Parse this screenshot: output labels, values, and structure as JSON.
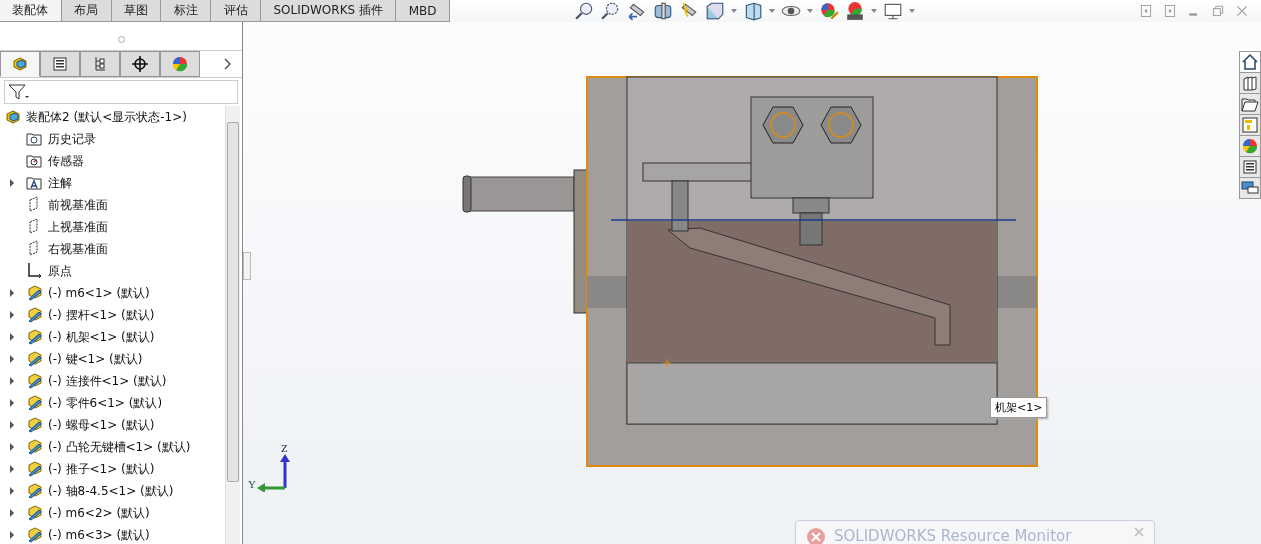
{
  "command_tabs": [
    {
      "label": "装配体",
      "selected": true
    },
    {
      "label": "布局",
      "selected": false
    },
    {
      "label": "草图",
      "selected": false
    },
    {
      "label": "标注",
      "selected": false
    },
    {
      "label": "评估",
      "selected": false
    },
    {
      "label": "SOLIDWORKS 插件",
      "selected": false
    },
    {
      "label": "MBD",
      "selected": false
    }
  ],
  "panel_tabs": [
    {
      "kind": "feature",
      "selected": true
    },
    {
      "kind": "property",
      "selected": false
    },
    {
      "kind": "config",
      "selected": false
    },
    {
      "kind": "dim",
      "selected": false
    },
    {
      "kind": "appearance",
      "selected": false
    }
  ],
  "tree": {
    "root": {
      "label": "装配体2  (默认<显示状态-1>)",
      "expanded": true
    },
    "items": [
      {
        "kind": "history",
        "label": "历史记录",
        "expandable": false
      },
      {
        "kind": "sensor",
        "label": "传感器",
        "expandable": false
      },
      {
        "kind": "annotation",
        "label": "注解",
        "expandable": true
      },
      {
        "kind": "plane",
        "label": "前视基准面",
        "expandable": false
      },
      {
        "kind": "plane",
        "label": "上视基准面",
        "expandable": false
      },
      {
        "kind": "plane",
        "label": "右视基准面",
        "expandable": false
      },
      {
        "kind": "origin",
        "label": "原点",
        "expandable": false
      },
      {
        "kind": "part",
        "label": "(-) m6<1> (默认)",
        "expandable": true
      },
      {
        "kind": "part",
        "label": "(-) 摆杆<1> (默认)",
        "expandable": true
      },
      {
        "kind": "part",
        "label": "(-) 机架<1> (默认)",
        "expandable": true
      },
      {
        "kind": "part",
        "label": "(-) 键<1> (默认)",
        "expandable": true
      },
      {
        "kind": "part",
        "label": "(-) 连接件<1> (默认)",
        "expandable": true
      },
      {
        "kind": "part",
        "label": "(-) 零件6<1> (默认)",
        "expandable": true
      },
      {
        "kind": "part",
        "label": "(-) 螺母<1> (默认)",
        "expandable": true
      },
      {
        "kind": "part",
        "label": "(-) 凸轮无键槽<1> (默认)",
        "expandable": true
      },
      {
        "kind": "part",
        "label": "(-) 推子<1> (默认)",
        "expandable": true
      },
      {
        "kind": "part",
        "label": "(-) 轴8-4.5<1> (默认)",
        "expandable": true
      },
      {
        "kind": "part",
        "label": "(-) m6<2> (默认)",
        "expandable": true
      },
      {
        "kind": "part",
        "label": "(-) m6<3> (默认)",
        "expandable": true
      }
    ]
  },
  "viewport": {
    "tooltip": "机架<1>",
    "triad": {
      "z_label": "Z",
      "y_label": "Y"
    }
  },
  "notification": {
    "title": "SOLIDWORKS Resource Monitor"
  }
}
